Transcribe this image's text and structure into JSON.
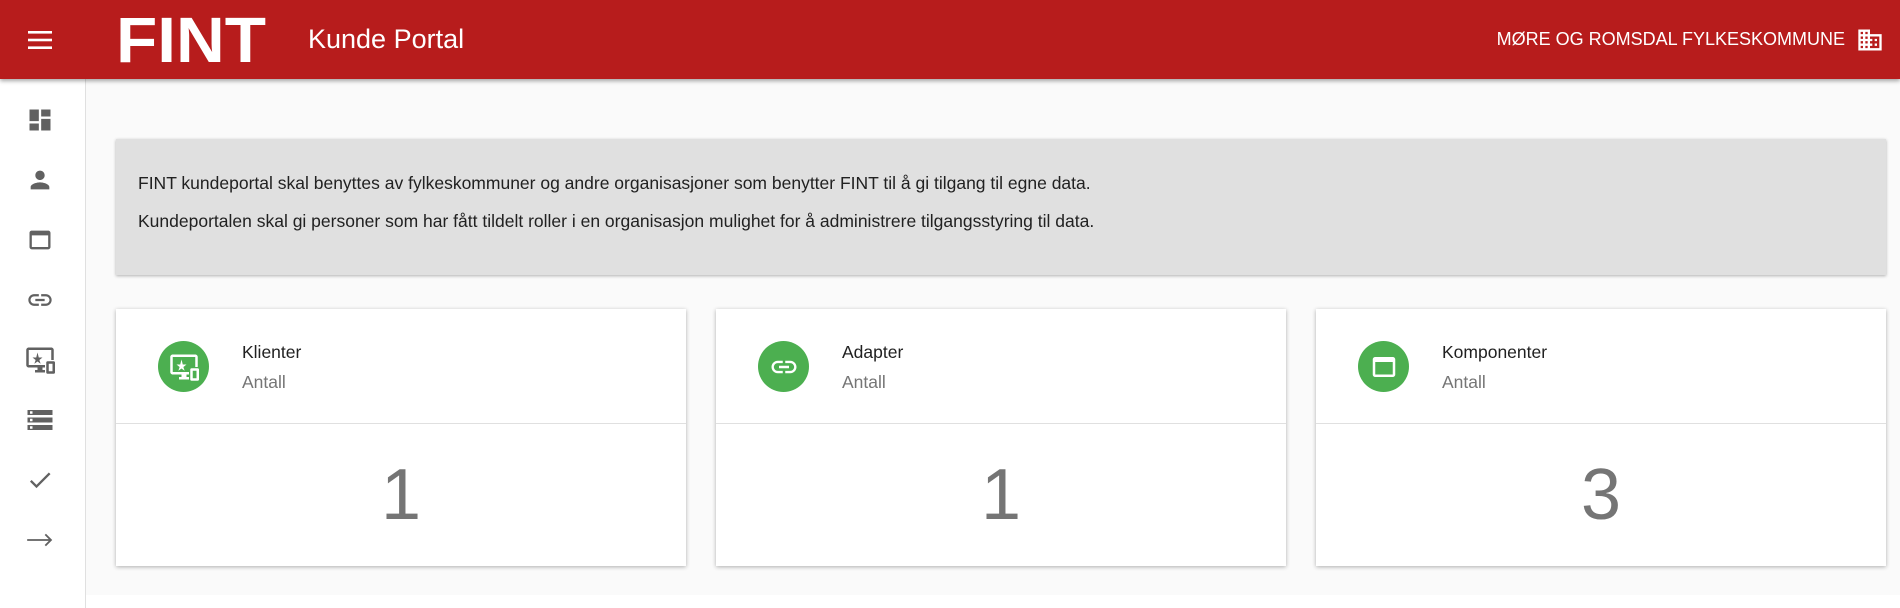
{
  "header": {
    "logo_text": "FINT",
    "app_title": "Kunde Portal",
    "organization": "MØRE OG ROMSDAL FYLKESKOMMUNE",
    "brand_color": "#b71c1c"
  },
  "sidebar": {
    "items": [
      {
        "icon": "dashboard-icon"
      },
      {
        "icon": "person-icon"
      },
      {
        "icon": "window-icon"
      },
      {
        "icon": "link-icon"
      },
      {
        "icon": "screen-star-icon"
      },
      {
        "icon": "storage-list-icon"
      },
      {
        "icon": "check-icon"
      },
      {
        "icon": "arrow-right-icon"
      }
    ]
  },
  "intro": {
    "line1": "FINT kundeportal skal benyttes av fylkeskommuner og andre organisasjoner som benytter FINT til å gi tilgang til egne data.",
    "line2": "Kundeportalen skal gi personer som har fått tildelt roller i en organisasjon mulighet for å administrere tilgangsstyring til data."
  },
  "cards": [
    {
      "title": "Klienter",
      "subtitle": "Antall",
      "value": "1",
      "icon": "client-screen-icon"
    },
    {
      "title": "Adapter",
      "subtitle": "Antall",
      "value": "1",
      "icon": "link-icon"
    },
    {
      "title": "Komponenter",
      "subtitle": "Antall",
      "value": "3",
      "icon": "window-icon"
    }
  ],
  "accent_color": "#4caf50"
}
